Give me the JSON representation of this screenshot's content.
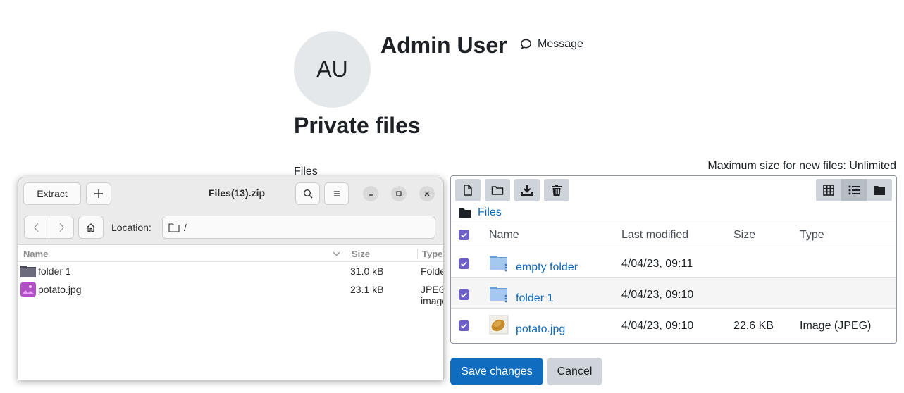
{
  "profile": {
    "initials": "AU",
    "name": "Admin User",
    "message_label": "Message"
  },
  "page": {
    "title": "Private files",
    "files_label": "Files",
    "max_size_text": "Maximum size for new files: Unlimited"
  },
  "filemanager": {
    "path_root": "Files",
    "columns": {
      "name": "Name",
      "modified": "Last modified",
      "size": "Size",
      "type": "Type"
    },
    "rows": [
      {
        "name": "empty folder",
        "modified": "4/04/23, 09:11",
        "size": "",
        "type": "",
        "kind": "folder-icon"
      },
      {
        "name": "folder 1",
        "modified": "4/04/23, 09:10",
        "size": "",
        "type": "",
        "kind": "folder-icon"
      },
      {
        "name": "potato.jpg",
        "modified": "4/04/23, 09:10",
        "size": "22.6 KB",
        "type": "Image (JPEG)",
        "kind": "image-thumbnail"
      }
    ],
    "save_label": "Save changes",
    "cancel_label": "Cancel",
    "colors": {
      "link": "#0f6cbf",
      "checkbox": "#6c5fc7",
      "button_primary": "#0f6cbf"
    }
  },
  "archive": {
    "extract_label": "Extract",
    "title": "Files(13).zip",
    "location_label": "Location:",
    "location_value": "/",
    "columns": {
      "name": "Name",
      "size": "Size",
      "type": "Type"
    },
    "rows": [
      {
        "name": "folder 1",
        "size": "31.0 kB",
        "type": "Folder"
      },
      {
        "name": "potato.jpg",
        "size": "23.1 kB",
        "type": "JPEG image"
      }
    ]
  }
}
